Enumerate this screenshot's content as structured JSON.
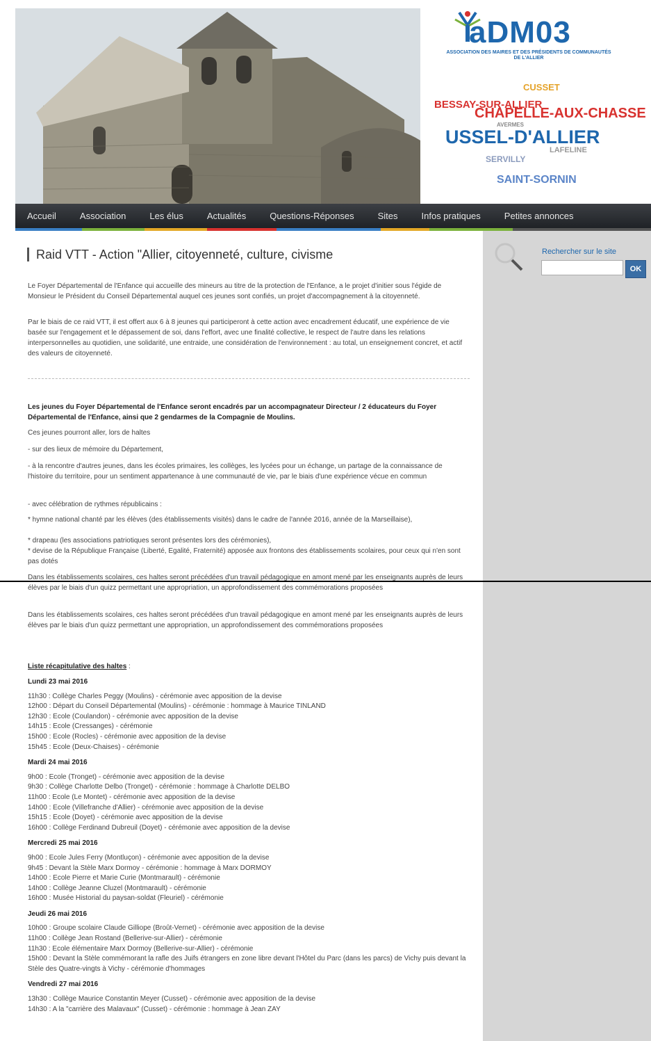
{
  "header": {
    "logo": {
      "word": "aDM03",
      "subtitle": "ASSOCIATION DES MAIRES ET DES PRÉSIDENTS DE COMMUNAUTÉS DE L'ALLIER"
    },
    "towns": [
      "CUSSET",
      "BESSAY-SUR-ALLIER",
      "CHAPELLE-AUX-CHASSE",
      "AVERMES",
      "USSEL-D'ALLIER",
      "LAFELINE",
      "SERVILLY",
      "SAINT-SORNIN"
    ]
  },
  "nav": {
    "items": [
      "Accueil",
      "Association",
      "Les élus",
      "Actualités",
      "Questions-Réponses",
      "Sites",
      "Infos pratiques",
      "Petites annonces"
    ]
  },
  "colors": {
    "nav_stripe": [
      "#3a7fc4",
      "#7bb13c",
      "#e3a826",
      "#d8322f",
      "#3a7fc4",
      "#e3a826",
      "#7bb13c",
      "#555555"
    ]
  },
  "article": {
    "title": "Raid VTT - Action \"Allier, citoyenneté, culture, civisme",
    "intro1": "Le Foyer Départemental de l'Enfance qui accueille des mineurs au titre de la protection de l'Enfance, a le projet d'initier sous l'égide de Monsieur le Président du Conseil Départemental auquel ces jeunes sont confiés, un projet d'accompagnement à la citoyenneté.",
    "intro2": "Par le biais de ce raid VTT, il est offert aux 6 à 8 jeunes qui participeront à cette action avec encadrement éducatif, une expérience de vie basée sur l'engagement et le dépassement de soi, dans l'effort, avec une finalité collective, le respect de l'autre dans les relations interpersonnelles au quotidien, une solidarité, une entraide, une considération de l'environnement : au total, un enseignement concret, et actif des valeurs de citoyenneté.",
    "bold_intro": "Les jeunes du Foyer Départemental de l'Enfance seront encadrés par un accompagnateur Directeur / 2 éducateurs du Foyer Départemental de l'Enfance, ainsi que 2 gendarmes de la Compagnie de Moulins.",
    "line1": "Ces jeunes pourront aller, lors de haltes",
    "line2": "- sur des lieux de mémoire du Département,",
    "line3": "- à la rencontre d'autres jeunes, dans les écoles primaires, les collèges, les lycées pour un échange, un partage de la connaissance de l'histoire du territoire, pour un sentiment appartenance à une communauté de vie, par le biais d'une expérience vécue en commun",
    "line4": "- avec célébration de rythmes républicains :",
    "bullet1": "* hymne national chanté par les élèves (des établissements visités) dans le cadre de l'année 2016, année de la Marseillaise),",
    "bullet2": "* drapeau (les associations patriotiques seront présentes lors des cérémonies),",
    "bullet3": "* devise de la République Française (Liberté, Egalité, Fraternité) apposée aux frontons des établissements scolaires, pour ceux qui n'en sont pas dotés",
    "schools": "Dans les établissements scolaires, ces haltes seront précédées d'un travail pédagogique en amont mené par les enseignants auprès de leurs élèves par le biais d'un quizz permettant une appropriation, un approfondissement des commémorations proposées",
    "schools_cut_tail": "commémorations proposées",
    "list_title": "Liste récapitulative des haltes",
    "list_title_suffix": " :",
    "days": [
      {
        "label": "Lundi 23 mai 2016",
        "items": [
          "11h30 : Collège Charles Peggy (Moulins) - cérémonie avec apposition de la devise",
          "12h00 : Départ du Conseil Départemental (Moulins) - cérémonie : hommage à Maurice TINLAND",
          "12h30 : Ecole (Coulandon) - cérémonie avec apposition de la devise",
          "14h15 : Ecole (Cressanges) - cérémonie",
          "15h00 : Ecole (Rocles) - cérémonie avec apposition de la devise",
          "15h45 : Ecole (Deux-Chaises) - cérémonie"
        ]
      },
      {
        "label": "Mardi 24 mai 2016",
        "items": [
          "9h00 : Ecole (Tronget) - cérémonie avec apposition de la devise",
          "9h30 : Collège Charlotte Delbo (Tronget) - cérémonie : hommage à Charlotte DELBO",
          "11h00 : Ecole (Le Montet) - cérémonie avec apposition de la devise",
          "14h00 : Ecole (Villefranche d'Allier) - cérémonie avec apposition de la devise",
          "15h15 : Ecole (Doyet) - cérémonie avec apposition de la devise",
          "16h00 : Collège Ferdinand Dubreuil (Doyet) - cérémonie avec apposition de la devise"
        ]
      },
      {
        "label": "Mercredi 25 mai 2016",
        "items": [
          "9h00 : Ecole Jules Ferry (Montluçon) - cérémonie avec apposition de la devise",
          "9h45 : Devant la Stèle Marx Dormoy - cérémonie : hommage à Marx DORMOY",
          "14h00 : Ecole Pierre et Marie Curie (Montmarault) - cérémonie",
          "14h00 : Collège Jeanne Cluzel (Montmarault) - cérémonie",
          "16h00 : Musée Historial du paysan-soldat (Fleuriel) - cérémonie"
        ]
      },
      {
        "label": "Jeudi 26 mai 2016",
        "items": [
          "10h00 : Groupe scolaire Claude Gilliope (Broût-Vernet) - cérémonie avec apposition de la devise",
          "11h00 : Collège Jean Rostand (Bellerive-sur-Allier) - cérémonie",
          "11h30 : Ecole élémentaire Marx Dormoy (Bellerive-sur-Allier) - cérémonie",
          "15h00 : Devant la Stèle commémorant la rafle des Juifs étrangers en zone libre devant l'Hôtel du Parc (dans les parcs) de Vichy puis devant la Stèle des Quatre-vingts à Vichy - cérémonie d'hommages"
        ]
      },
      {
        "label": "Vendredi 27 mai 2016",
        "items": [
          "13h30 : Collège Maurice Constantin Meyer (Cusset) - cérémonie avec apposition de la devise",
          "14h30 : A la \"carrière des Malavaux\" (Cusset) - cérémonie : hommage à Jean ZAY"
        ]
      }
    ]
  },
  "sidebar": {
    "search_label": "Rechercher sur le site",
    "search_value": "",
    "ok_label": "OK"
  }
}
